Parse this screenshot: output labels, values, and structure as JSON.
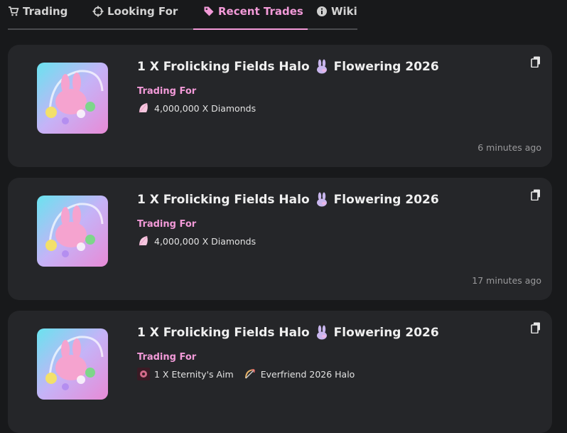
{
  "tabs": [
    {
      "label": "Trading",
      "icon": "cart-icon"
    },
    {
      "label": "Looking For",
      "icon": "crosshair-icon"
    },
    {
      "label": "Recent Trades",
      "icon": "tag-icon",
      "active": true
    },
    {
      "label": "Wiki",
      "icon": "info-icon"
    }
  ],
  "colors": {
    "background": "#18191b",
    "card": "#252629",
    "accent": "#f29ad8",
    "muted": "#9a9a9c"
  },
  "trades": [
    {
      "title_left": "1 X Frolicking Fields Halo",
      "title_right": "Flowering 2026",
      "trading_for_label": "Trading For",
      "offer_parts": [
        "4,000,000 X Diamonds"
      ],
      "time": "6 minutes ago"
    },
    {
      "title_left": "1 X Frolicking Fields Halo",
      "title_right": "Flowering 2026",
      "trading_for_label": "Trading For",
      "offer_parts": [
        "4,000,000 X Diamonds"
      ],
      "time": "17 minutes ago"
    },
    {
      "title_left": "1 X Frolicking Fields Halo",
      "title_right": "Flowering 2026",
      "trading_for_label": "Trading For",
      "offer_parts": [
        "1 X Eternity's Aim",
        "Everfriend 2026 Halo"
      ],
      "time": ""
    }
  ]
}
